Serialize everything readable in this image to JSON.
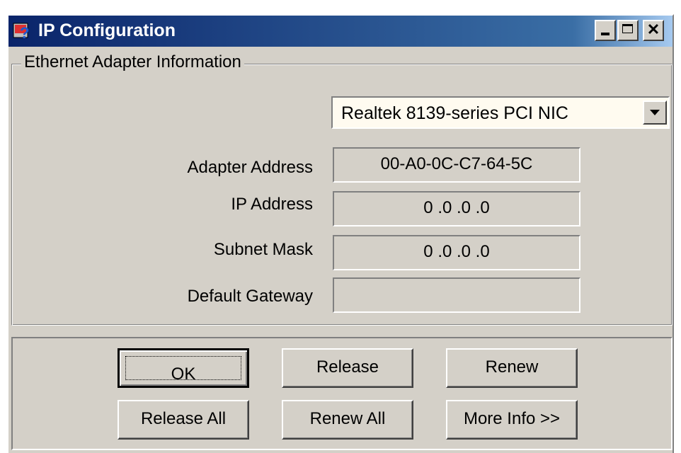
{
  "window": {
    "title": "IP Configuration",
    "controls": {
      "minimize": "",
      "maximize": "",
      "close": "✕"
    }
  },
  "adapter_group": {
    "legend": "Ethernet  Adapter Information",
    "selected_adapter": "Realtek 8139-series PCI NIC"
  },
  "fields": {
    "adapter_address": {
      "label": "Adapter Address",
      "value": "00-A0-0C-C7-64-5C"
    },
    "ip_address": {
      "label": "IP Address",
      "value": "0 .0 .0 .0"
    },
    "subnet_mask": {
      "label": "Subnet Mask",
      "value": "0 .0 .0 .0"
    },
    "default_gateway": {
      "label": "Default Gateway",
      "value": ""
    }
  },
  "buttons": {
    "ok": "OK",
    "release": "Release",
    "renew": "Renew",
    "release_all": "Release All",
    "renew_all": "Renew All",
    "more_info": "More Info >>"
  },
  "icons": {
    "app": "network-question-icon",
    "minimize": "minimize-icon",
    "maximize": "maximize-icon",
    "close": "close-icon",
    "dropdown": "dropdown-arrow-icon"
  },
  "colors": {
    "titlebar_start": "#0a246a",
    "titlebar_end": "#a6caf0",
    "face": "#d4d0c8"
  }
}
